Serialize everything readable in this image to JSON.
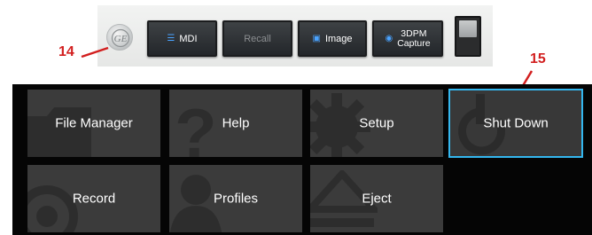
{
  "toolbar": {
    "mdi_label": "MDI",
    "recall_label": "Recall",
    "image_label": "Image",
    "capture_line1": "3DPM",
    "capture_line2": "Capture"
  },
  "callouts": {
    "logo": "14",
    "shutdown": "15"
  },
  "menu": {
    "items": [
      {
        "label": "File Manager"
      },
      {
        "label": "Help"
      },
      {
        "label": "Setup"
      },
      {
        "label": "Shut Down"
      },
      {
        "label": "Record"
      },
      {
        "label": "Profiles"
      },
      {
        "label": "Eject"
      }
    ],
    "selected_index": 3,
    "selected_border_color": "#34b7ef",
    "tile_color": "#3b3b3b"
  },
  "colors": {
    "callout": "#d21f1f",
    "accent_icon": "#4aa3ff"
  }
}
